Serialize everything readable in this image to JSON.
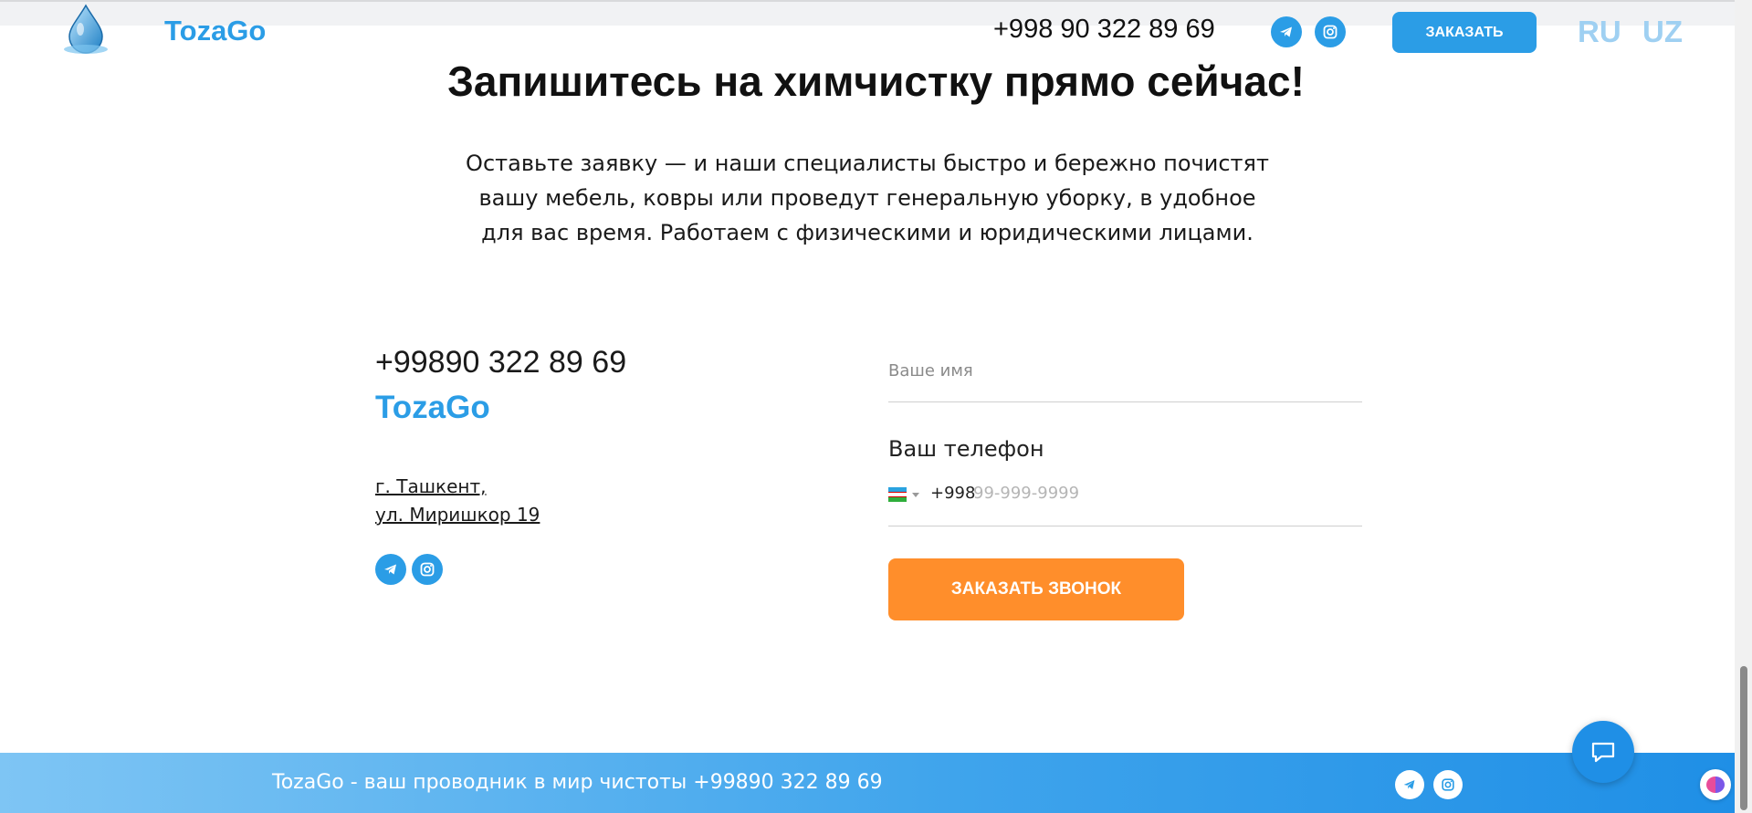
{
  "header": {
    "brand": "TozaGo",
    "phone": "+998 90 322 89 69",
    "order_button": "ЗАКАЗАТЬ",
    "languages": [
      "RU",
      "UZ"
    ]
  },
  "hero": {
    "title": "Запишитесь на химчистку прямо сейчас!",
    "lead_lines": [
      "Оставьте заявку — и наши специалисты быстро и бережно почистят",
      "вашу мебель, ковры или проведут генеральную уборку, в удобное",
      "для вас время. Работаем с физическими и юридическими лицами."
    ]
  },
  "contacts": {
    "phone": "+99890 322 89 69",
    "brand": "TozaGo",
    "address_lines": [
      "г. Ташкент,",
      "ул. Миришкор 19"
    ]
  },
  "form": {
    "name_placeholder": "Ваше имя",
    "phone_label": "Ваш телефон",
    "country_code": "+998",
    "phone_placeholder": "99-999-9999",
    "submit_label": "ЗАКАЗАТЬ ЗВОНОК"
  },
  "footer": {
    "text": "TozaGo - ваш проводник в мир чистоты +99890 322 89 69"
  },
  "icons": [
    "water-drop-logo-icon",
    "telegram-icon",
    "instagram-icon",
    "chat-icon",
    "caret-down-icon",
    "uzbekistan-flag-icon"
  ],
  "colors": {
    "brand": "#2b9de6",
    "accent": "#ff8e2b",
    "language_inactive": "#9fd0f2"
  }
}
